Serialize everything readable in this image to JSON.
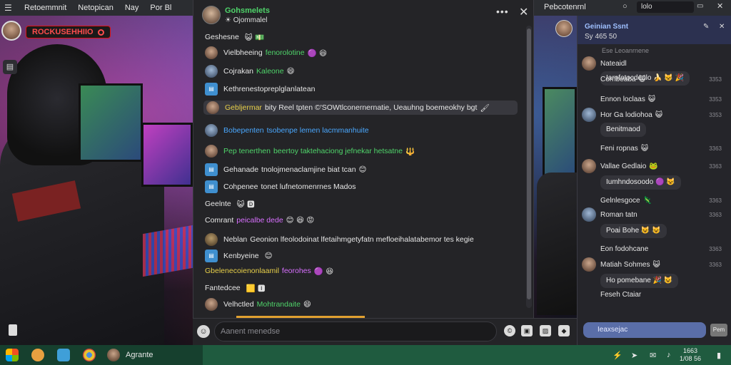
{
  "topbar": {
    "tabs": [
      "Retoemmnit",
      "Netopican",
      "Nay",
      "Por Bl"
    ],
    "right_tab": "Pebcotenrnl",
    "right_search": "lolo"
  },
  "stream": {
    "live_text": "ROCKUSEHHIIO"
  },
  "chat": {
    "header_name": "Gohsmelets",
    "header_sub": "☀ Ojommalel",
    "more": "•••",
    "close": "✕",
    "messages": [
      {
        "user": "Geshesne",
        "user_color": "white",
        "text": "",
        "text_color": "white",
        "emoji": "😺 💵",
        "avatar": "none"
      },
      {
        "user": "Vielbheeing",
        "user_color": "white",
        "text": "fenorolotine",
        "text_color": "green",
        "emoji": "🟣 😆",
        "avatar": "pic"
      },
      {
        "user": "Cojrakan",
        "user_color": "white",
        "text": "Kaleone",
        "text_color": "green",
        "emoji": "😄",
        "avatar": "pic2"
      },
      {
        "user": "Kethrenestopreplglanlatean",
        "user_color": "white",
        "text": "",
        "text_color": "white",
        "emoji": "",
        "avatar": "sq"
      },
      {
        "user": "Gebljermar",
        "user_color": "yellow",
        "text": "bity Reel tpten ©'SOWtlconernernatie, Ueauhng boemeokhy bgt",
        "text_color": "white",
        "emoji": "🖌",
        "avatar": "pic",
        "highlight": true
      },
      {
        "user": "Bobepenten",
        "user_color": "blue",
        "text": "tsobenpe lemen lacmmanhuite",
        "text_color": "blue",
        "emoji": "",
        "avatar": "pic2"
      },
      {
        "user": "Pep tenerthen",
        "user_color": "green",
        "text": "beertoy taktehaciong jefnekar hetsatne",
        "text_color": "green",
        "emoji": "🔱",
        "avatar": "pic"
      },
      {
        "user": "Gehanade",
        "user_color": "white",
        "text": "tnolojmenaclamjine biat tcan",
        "text_color": "white",
        "emoji": "😊",
        "avatar": "sq"
      },
      {
        "user": "Cohpenee",
        "user_color": "white",
        "text": "tonet lufnetomenrnes Mados",
        "text_color": "white",
        "emoji": "",
        "avatar": "sq"
      },
      {
        "user": "Geelnte",
        "user_color": "white",
        "text": "",
        "text_color": "white",
        "emoji": "😺 🅳",
        "avatar": "none"
      },
      {
        "user": "Comrant",
        "user_color": "white",
        "text": "peicalbe dede",
        "text_color": "pink",
        "emoji": "😊 😆 😡",
        "avatar": "none"
      },
      {
        "user": "Neblan",
        "user_color": "white",
        "text": "Geonion lfeolodoinat lfetaihmgetyfatn mefloeihalatabemor tes kegie",
        "text_color": "white",
        "emoji": "",
        "avatar": "pic3"
      },
      {
        "user": "Kenbyeine",
        "user_color": "white",
        "text": "",
        "text_color": "white",
        "emoji": "😊",
        "avatar": "sq"
      },
      {
        "user": "Gbelenecoienonlaamil",
        "user_color": "yellow",
        "text": "feorohes",
        "text_color": "pink",
        "emoji": "🟣 😆",
        "avatar": "none"
      },
      {
        "user": "Fantedcee",
        "user_color": "white",
        "text": "",
        "text_color": "white",
        "emoji": "🟨 🅸",
        "avatar": "none"
      },
      {
        "user": "Velhctled",
        "user_color": "white",
        "text": "Mohtrandaite",
        "text_color": "green",
        "emoji": "😄",
        "avatar": "pic"
      }
    ],
    "input_placeholder": "Aanent menedse"
  },
  "rpanel": {
    "title": "Geinian Ssnt",
    "subtitle": "Sy 465 50",
    "subtitle2": "Ese Leoanrnene",
    "rows": [
      {
        "name": "Nateaidl",
        "time": "",
        "bubble": "Iarnfotocdeolo 🍌 😺 🎉",
        "avatar": "pic"
      },
      {
        "name": "Cornbeaba",
        "time": "3353",
        "bubble": "",
        "avatar": "empty",
        "emoji": "😺"
      },
      {
        "name": "Ennon loclaas",
        "time": "3353",
        "bubble": "",
        "avatar": "empty",
        "emoji": "😺"
      },
      {
        "name": "Hor Ga lodiohoa",
        "time": "3353",
        "bubble": "",
        "avatar": "pic2",
        "emoji": "😺"
      },
      {
        "name": "",
        "time": "",
        "bubble": "Benitmaod",
        "avatar": "empty"
      },
      {
        "name": "Feni ropnas",
        "time": "3363",
        "bubble": "",
        "avatar": "empty",
        "emoji": "😺"
      },
      {
        "name": "Vallae Gedlaio",
        "time": "3363",
        "bubble": "",
        "avatar": "pic",
        "emoji": "🐸"
      },
      {
        "name": "",
        "time": "",
        "bubble": "Iumhndosoodo 🟣 😺",
        "avatar": "empty"
      },
      {
        "name": "Gelnlesgoce",
        "time": "3363",
        "bubble": "",
        "avatar": "empty",
        "emoji": "🦎"
      },
      {
        "name": "Roman tatn",
        "time": "3363",
        "bubble": "",
        "avatar": "pic2"
      },
      {
        "name": "",
        "time": "",
        "bubble": "Poai Bohe 😺 😺",
        "avatar": "empty"
      },
      {
        "name": "Eon fodohcane",
        "time": "3363",
        "bubble": "",
        "avatar": "empty"
      },
      {
        "name": "Matiah Sohmes",
        "time": "3363",
        "bubble": "",
        "avatar": "pic",
        "emoji": "😺"
      },
      {
        "name": "",
        "time": "",
        "bubble": "Ho pomebane 🎉 😺",
        "avatar": "empty"
      },
      {
        "name": "Feseh Ctaiar",
        "time": "",
        "bubble": "",
        "avatar": "empty"
      }
    ],
    "input_placeholder": "Ieaxsejac",
    "send": "Pem"
  },
  "taskbar": {
    "app_label": "Agrante",
    "clock_time": "1663",
    "clock_date": "1/08 56"
  },
  "colors": {
    "accent_green": "#4fd46a",
    "accent_blue": "#4aa8ff",
    "live_red": "#ff4d4d",
    "taskbar": "#1f5b3f"
  }
}
